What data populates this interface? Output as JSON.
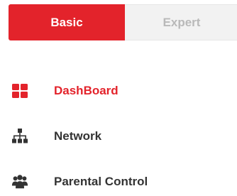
{
  "mode_toggle": {
    "basic_label": "Basic",
    "expert_label": "Expert",
    "selected": "Basic"
  },
  "nav": {
    "items": [
      {
        "label": "DashBoard",
        "icon": "dashboard-grid-icon",
        "active": true
      },
      {
        "label": "Network",
        "icon": "network-topology-icon",
        "active": false
      },
      {
        "label": "Parental Control",
        "icon": "parental-control-users-icon",
        "active": false
      }
    ]
  },
  "colors": {
    "accent": "#e3232b",
    "text": "#333333",
    "inactive_tab_text": "#b9b9b9",
    "inactive_tab_bg": "#f2f2f2"
  }
}
